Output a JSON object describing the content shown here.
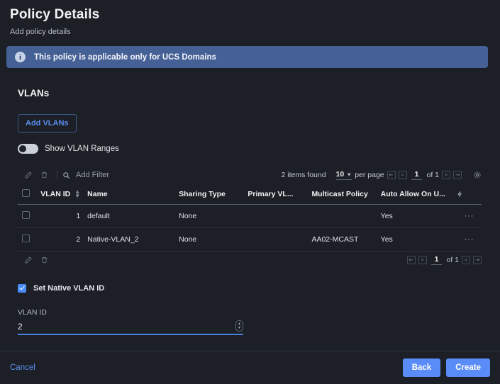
{
  "header": {
    "title": "Policy Details",
    "subtitle": "Add policy details"
  },
  "banner": {
    "icon": "info-icon",
    "text": "This policy is applicable only for UCS Domains"
  },
  "vlans": {
    "section_title": "VLANs",
    "add_button": "Add VLANs",
    "toggle_label": "Show VLAN Ranges",
    "toggle_state": "off"
  },
  "table_toolbar": {
    "edit_icon": "pencil-icon",
    "delete_icon": "trash-icon",
    "search_icon": "search-icon",
    "filter_placeholder": "Add Filter",
    "filter_value": "",
    "items_found": "2 items found",
    "per_page_value": "10",
    "per_page_label": "per page",
    "page_current": "1",
    "page_of": "of 1",
    "settings_icon": "gear-icon"
  },
  "table": {
    "columns": [
      {
        "label": "",
        "key": "check"
      },
      {
        "label": "VLAN ID",
        "key": "vlan_id",
        "sortable": true
      },
      {
        "label": "Name",
        "key": "name",
        "sortable": true
      },
      {
        "label": "Sharing Type",
        "key": "sharing_type",
        "sortable": true
      },
      {
        "label": "Primary VL...",
        "key": "primary_vlan",
        "sortable": true
      },
      {
        "label": "Multicast Policy",
        "key": "multicast_policy",
        "sortable": false
      },
      {
        "label": "Auto Allow On U...",
        "key": "auto_allow",
        "sortable": false
      },
      {
        "label": "",
        "key": "actions",
        "icon": "lightning-icon"
      }
    ],
    "rows": [
      {
        "vlan_id": "1",
        "name": "default",
        "sharing_type": "None",
        "primary_vlan": "",
        "multicast_policy": "",
        "auto_allow": "Yes",
        "actions": "···"
      },
      {
        "vlan_id": "2",
        "name": "Native-VLAN_2",
        "sharing_type": "None",
        "primary_vlan": "",
        "multicast_policy": "AA02-MCAST",
        "auto_allow": "Yes",
        "actions": "···"
      }
    ]
  },
  "table_footer": {
    "edit_icon": "pencil-icon",
    "delete_icon": "trash-icon",
    "page_current": "1",
    "page_of": "of 1"
  },
  "native_vlan": {
    "checkbox_label": "Set Native VLAN ID",
    "checkbox_state": "checked",
    "field_label": "VLAN ID",
    "field_value": "2",
    "field_placeholder": ""
  },
  "footer": {
    "cancel": "Cancel",
    "back": "Back",
    "create": "Create"
  },
  "colors": {
    "page_bg": "#1c2026",
    "banner_bg": "#456095",
    "accent": "#5a8cf8",
    "link": "#5b8def",
    "field_underline": "#4a7fe0"
  }
}
